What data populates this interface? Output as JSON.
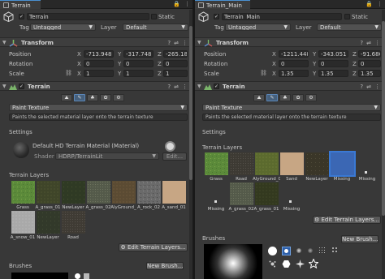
{
  "left": {
    "tab": {
      "label": "Terrain"
    },
    "object": {
      "name": "Terrain",
      "static_label": "Static",
      "tag_label": "Tag",
      "tag_value": "Untagged",
      "layer_label": "Layer",
      "layer_value": "Default"
    },
    "transform": {
      "title": "Transform",
      "position": {
        "label": "Position",
        "x": "-713.948",
        "y": "-317.748",
        "z": "-265.1865"
      },
      "rotation": {
        "label": "Rotation",
        "x": "0",
        "y": "0",
        "z": "0"
      },
      "scale": {
        "label": "Scale",
        "x": "1",
        "y": "1",
        "z": "1"
      }
    },
    "terrain": {
      "title": "Terrain",
      "mode": "Paint Texture",
      "help": "Paints the selected material layer onto the terrain texture",
      "settings_label": "Settings",
      "material_name": "Default HD Terrain Material (Material)",
      "shader_label": "Shader",
      "shader_value": "HDRP/TerrainLit",
      "edit_label": "Edit...",
      "layers_label": "Terrain Layers",
      "layers": [
        "Grass",
        "A_grass_01",
        "NewLayer",
        "A_grass_02",
        "AlyGround_",
        "A_rock_02",
        "A_sand_01",
        "A_snow_01",
        "NewLayer",
        "Road"
      ],
      "edit_layers_label": "Edit Terrain Layers...",
      "brushes_label": "Brushes",
      "new_brush_label": "New Brush..."
    }
  },
  "right": {
    "tab": {
      "label": "Terrain_Main"
    },
    "object": {
      "name": "Terrain_Main",
      "static_label": "Static",
      "tag_label": "Tag",
      "tag_value": "Untagged",
      "layer_label": "Layer",
      "layer_value": "Default"
    },
    "transform": {
      "title": "Transform",
      "position": {
        "label": "Position",
        "x": "-1211.448",
        "y": "-343.051",
        "z": "-91.68646"
      },
      "rotation": {
        "label": "Rotation",
        "x": "0",
        "y": "0",
        "z": "0"
      },
      "scale": {
        "label": "Scale",
        "x": "1.35",
        "y": "1.35",
        "z": "1.35"
      }
    },
    "terrain": {
      "title": "Terrain",
      "mode": "Paint Texture",
      "help": "Paints the selected material layer onto the terrain texture",
      "settings_label": "Settings",
      "layers_label": "Terrain Layers",
      "layers": [
        "Grass",
        "Road",
        "AlyGround_0",
        "Sand",
        "NewLayer",
        "Missing",
        "Missing",
        "A_grass_02",
        "A_grass_01",
        "Missing"
      ],
      "edit_layers_label": "Edit Terrain Layers...",
      "brushes_label": "Brushes",
      "new_brush_label": "New Brush..."
    }
  },
  "axes": {
    "x": "X",
    "y": "Y",
    "z": "Z"
  },
  "colors": {
    "accent": "#3a79d4",
    "panel": "#383838",
    "field": "#2a2a2a"
  }
}
